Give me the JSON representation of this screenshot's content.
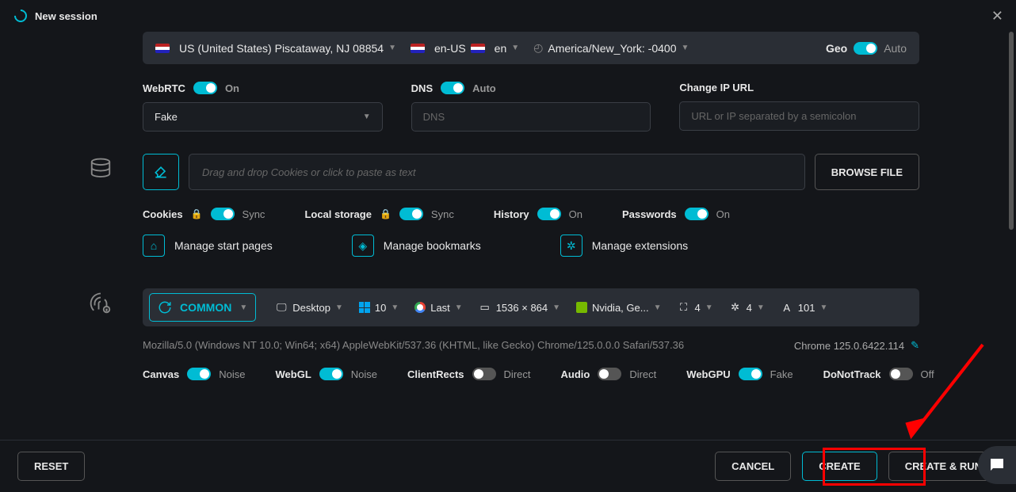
{
  "header": {
    "title": "New session"
  },
  "top": {
    "location": "US (United States) Piscataway, NJ 08854",
    "locale1": "en-US",
    "locale2": "en",
    "timezone": "America/New_York: -0400",
    "geo_label": "Geo",
    "geo_value": "Auto"
  },
  "webrtc": {
    "label": "WebRTC",
    "status": "On",
    "select": "Fake"
  },
  "dns": {
    "label": "DNS",
    "status": "Auto",
    "placeholder": "DNS"
  },
  "changeip": {
    "label": "Change IP URL",
    "placeholder": "URL or IP separated by a semicolon"
  },
  "cookies": {
    "input_placeholder": "Drag and drop Cookies or click to paste as text",
    "browse": "BROWSE FILE",
    "toggles": {
      "cookies": {
        "label": "Cookies",
        "value": "Sync"
      },
      "localstorage": {
        "label": "Local storage",
        "value": "Sync"
      },
      "history": {
        "label": "History",
        "value": "On"
      },
      "passwords": {
        "label": "Passwords",
        "value": "On"
      }
    },
    "manage": {
      "start": "Manage start pages",
      "bookmarks": "Manage bookmarks",
      "extensions": "Manage extensions"
    }
  },
  "fingerprint": {
    "common": "COMMON",
    "device": "Desktop",
    "os": "10",
    "browser": "Last",
    "resolution": "1536 × 864",
    "gpu": "Nvidia, Ge...",
    "cores": "4",
    "ram": "4",
    "fonts": "101",
    "ua": "Mozilla/5.0 (Windows NT 10.0; Win64; x64) AppleWebKit/537.36 (KHTML, like Gecko) Chrome/125.0.0.0 Safari/537.36",
    "chrome_ver": "Chrome 125.0.6422.114",
    "noise": {
      "canvas": {
        "label": "Canvas",
        "value": "Noise",
        "on": true
      },
      "webgl": {
        "label": "WebGL",
        "value": "Noise",
        "on": true
      },
      "clientrects": {
        "label": "ClientRects",
        "value": "Direct",
        "on": false
      },
      "audio": {
        "label": "Audio",
        "value": "Direct",
        "on": false
      },
      "webgpu": {
        "label": "WebGPU",
        "value": "Fake",
        "on": true
      },
      "dnt": {
        "label": "DoNotTrack",
        "value": "Off",
        "on": false
      }
    }
  },
  "footer": {
    "reset": "RESET",
    "cancel": "CANCEL",
    "create": "CREATE",
    "create_run": "CREATE & RUN"
  }
}
